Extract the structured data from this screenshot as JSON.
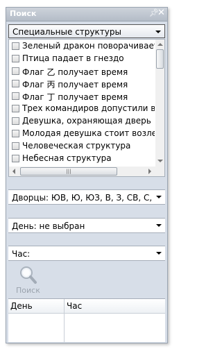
{
  "panel": {
    "title": "Поиск"
  },
  "structures_select": {
    "value": "Специальные структуры"
  },
  "structures_list": [
    {
      "label": "Зеленый дракон поворачивает голову"
    },
    {
      "label": "Птица падает в гнездо"
    },
    {
      "label": "Флаг 乙 получает время"
    },
    {
      "label": "Флаг 丙 получает время"
    },
    {
      "label": "Флаг 丁 получает время"
    },
    {
      "label": "Трех командиров допустили в главный зал"
    },
    {
      "label": "Девушка, охраняющая дверь"
    },
    {
      "label": "Молодая девушка стоит возле двери"
    },
    {
      "label": "Человеческая структура"
    },
    {
      "label": "Небесная структура"
    }
  ],
  "hscroll": {
    "grip": "|||"
  },
  "palaces_select": {
    "value": "Дворцы: ЮВ, Ю, ЮЗ, В, З, СВ, С, СЗ"
  },
  "day_select": {
    "value": "День: не выбран"
  },
  "hour_select": {
    "value": "Час:"
  },
  "search_button": {
    "label": "Поиск",
    "icon": "magnifier-icon"
  },
  "results_table": {
    "columns": [
      "День",
      "Час"
    ]
  },
  "colors": {
    "panel_bg": "#d7dee8",
    "title_bar": "#b4bcc7",
    "border": "#9aa4b1",
    "disabled_text": "#9ba3ad"
  }
}
